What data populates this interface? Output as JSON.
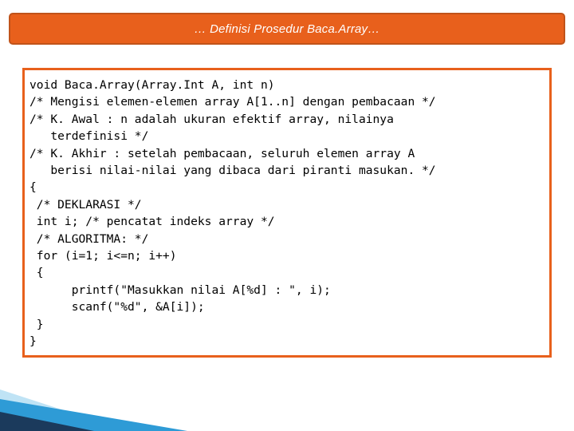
{
  "slide": {
    "title": "… Definisi Prosedur Baca.Array…",
    "theme": {
      "accent": "#E8601C",
      "accent_border": "#C0531A",
      "title_text_color": "#FFFFFF",
      "code_text_color": "#000000",
      "deco_blue_dark": "#1B3A5C",
      "deco_blue_mid": "#2E9BD6",
      "deco_blue_light": "#BFE3F5"
    },
    "code_lines": [
      "void Baca.Array(Array.Int A, int n)",
      "/* Mengisi elemen-elemen array A[1..n] dengan pembacaan */",
      "/* K. Awal : n adalah ukuran efektif array, nilainya",
      "   terdefinisi */",
      "/* K. Akhir : setelah pembacaan, seluruh elemen array A",
      "   berisi nilai-nilai yang dibaca dari piranti masukan. */",
      "{",
      " /* DEKLARASI */",
      " int i; /* pencatat indeks array */",
      " /* ALGORITMA: */",
      " for (i=1; i<=n; i++)",
      " {",
      "      printf(\"Masukkan nilai A[%d] : \", i);",
      "      scanf(\"%d\", &A[i]);",
      " }",
      "}"
    ]
  }
}
